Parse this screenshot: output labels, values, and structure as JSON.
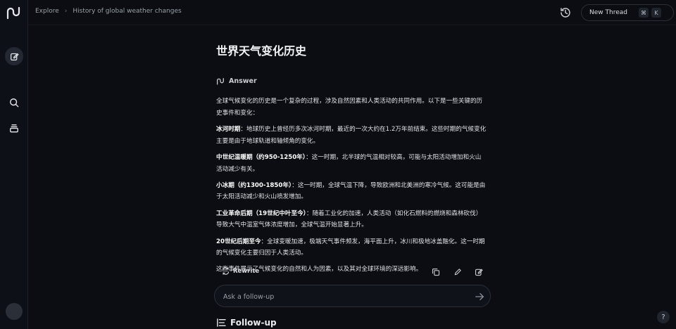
{
  "breadcrumb": {
    "root": "Explore",
    "current": "History of global weather changes"
  },
  "header": {
    "new_thread_label": "New Thread",
    "shortcut_mod": "⌘",
    "shortcut_key": "K"
  },
  "thread": {
    "title": "世界天气变化历史",
    "answer_label": "Answer",
    "paragraphs": [
      {
        "bold": "",
        "text": "全球气候变化的历史是一个复杂的过程，涉及自然因素和人类活动的共同作用。以下是一些关键的历史事件和变化："
      },
      {
        "bold": "冰河时期",
        "text": "：地球历史上曾经历多次冰河时期，最近的一次大约在1.2万年前结束。这些时期的气候变化主要是由于地球轨道和轴倾角的变化。"
      },
      {
        "bold": "中世纪温暖期（约950-1250年）",
        "text": "：这一时期，北半球的气温相对较高，可能与太阳活动增加和火山活动减少有关。"
      },
      {
        "bold": "小冰期（约1300-1850年）",
        "text": "：这一时期，全球气温下降，导致欧洲和北美洲的寒冷气候。这可能是由于太阳活动减少和火山喷发增加。"
      },
      {
        "bold": "工业革命后期（19世纪中叶至今）",
        "text": "：随着工业化的加速，人类活动（如化石燃料的燃烧和森林砍伐）导致大气中温室气体浓度增加，全球气温开始显著上升。"
      },
      {
        "bold": "20世纪后期至今",
        "text": "：全球变暖加速，极端天气事件频发，海平面上升，冰川和极地冰盖融化。这一时期的气候变化主要归因于人类活动。"
      },
      {
        "bold": "",
        "text": "这些事件展示了气候变化的自然和人为因素，以及其对全球环境的深远影响。"
      }
    ],
    "rewrite_label": "Rewrite"
  },
  "followup": {
    "placeholder": "Ask a follow-up",
    "title": "Follow-up"
  },
  "help_label": "?",
  "colors": {
    "background": "#0b0d12",
    "sidebar": "#0d1016",
    "border": "#2a2f38",
    "text": "#e6e8ec"
  }
}
